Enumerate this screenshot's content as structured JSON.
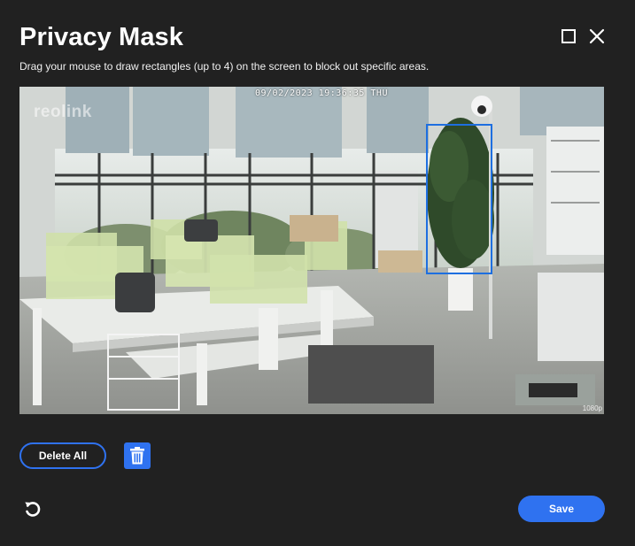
{
  "dialog": {
    "title": "Privacy Mask",
    "subtitle": "Drag your mouse to draw rectangles (up to 4) on the screen to block out specific areas."
  },
  "window_controls": {
    "maximize_icon": "square-icon",
    "close_icon": "x-icon"
  },
  "preview": {
    "timestamp": "09/02/2023 19:36:35 THU",
    "watermark": "reolink",
    "corner_label": "1080p",
    "mask_color": "#4e4e4e",
    "selection_color": "#1e6fe0"
  },
  "actions": {
    "delete_all_label": "Delete All",
    "trash_icon": "trash-icon",
    "refresh_icon": "refresh-icon",
    "save_label": "Save"
  },
  "colors": {
    "background": "#212121",
    "accent": "#2f72f0"
  }
}
